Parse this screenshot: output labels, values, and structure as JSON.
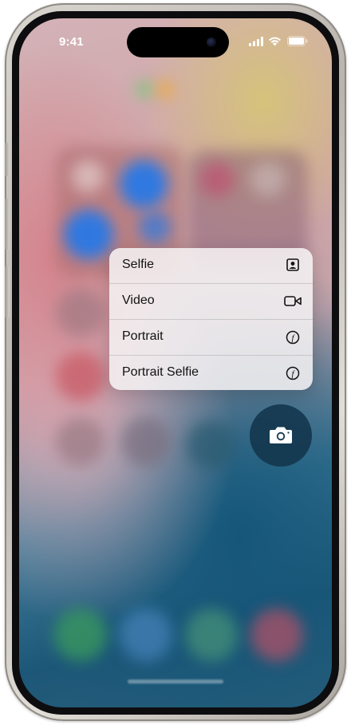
{
  "status_bar": {
    "time": "9:41",
    "icons": [
      "cellular-signal-icon",
      "wifi-icon",
      "battery-icon"
    ]
  },
  "camera_menu": {
    "items": [
      {
        "label": "Selfie",
        "icon": "selfie-portrait-frame-icon"
      },
      {
        "label": "Video",
        "icon": "video-camera-icon"
      },
      {
        "label": "Portrait",
        "icon": "aperture-f-icon"
      },
      {
        "label": "Portrait Selfie",
        "icon": "aperture-f-icon"
      }
    ]
  },
  "camera_button": {
    "icon": "camera-icon"
  },
  "colors": {
    "menu_background": "#F6F3F5",
    "camera_button": "#14374E",
    "text": "#111111"
  }
}
